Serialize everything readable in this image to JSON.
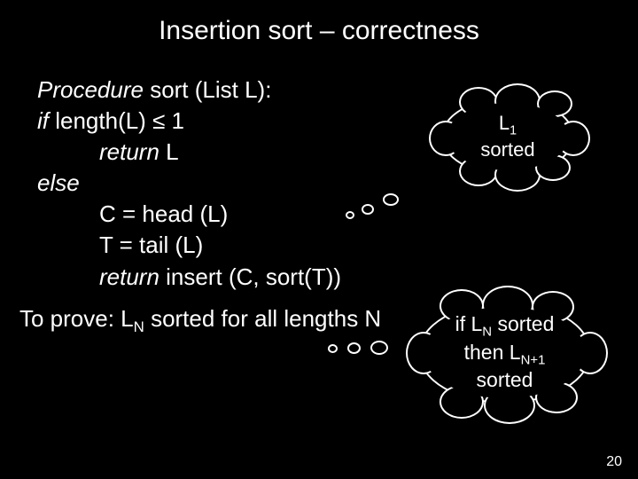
{
  "title": "Insertion sort – correctness",
  "code": {
    "l1a": "Procedure",
    "l1b": " sort (List L):",
    "l2a": "if",
    "l2b": "  length(L) ≤ 1",
    "l3a": "return",
    "l3b": " L",
    "l4": "else",
    "l5": "C = head (L)",
    "l6": "T = tail (L)",
    "l7a": "return ",
    "l7b": " insert (C, sort(T))"
  },
  "cloud1": {
    "line1a": "L",
    "line1sub": "1",
    "line2": "sorted"
  },
  "cloud2": {
    "l1a": "if L",
    "l1sub": "N",
    "l1b": " sorted",
    "l2a": "then L",
    "l2sub": "N+1",
    "l3": "sorted"
  },
  "prove": {
    "a": "To prove: L",
    "sub": "N",
    "b": " sorted for all lengths N"
  },
  "pagenum": "20"
}
